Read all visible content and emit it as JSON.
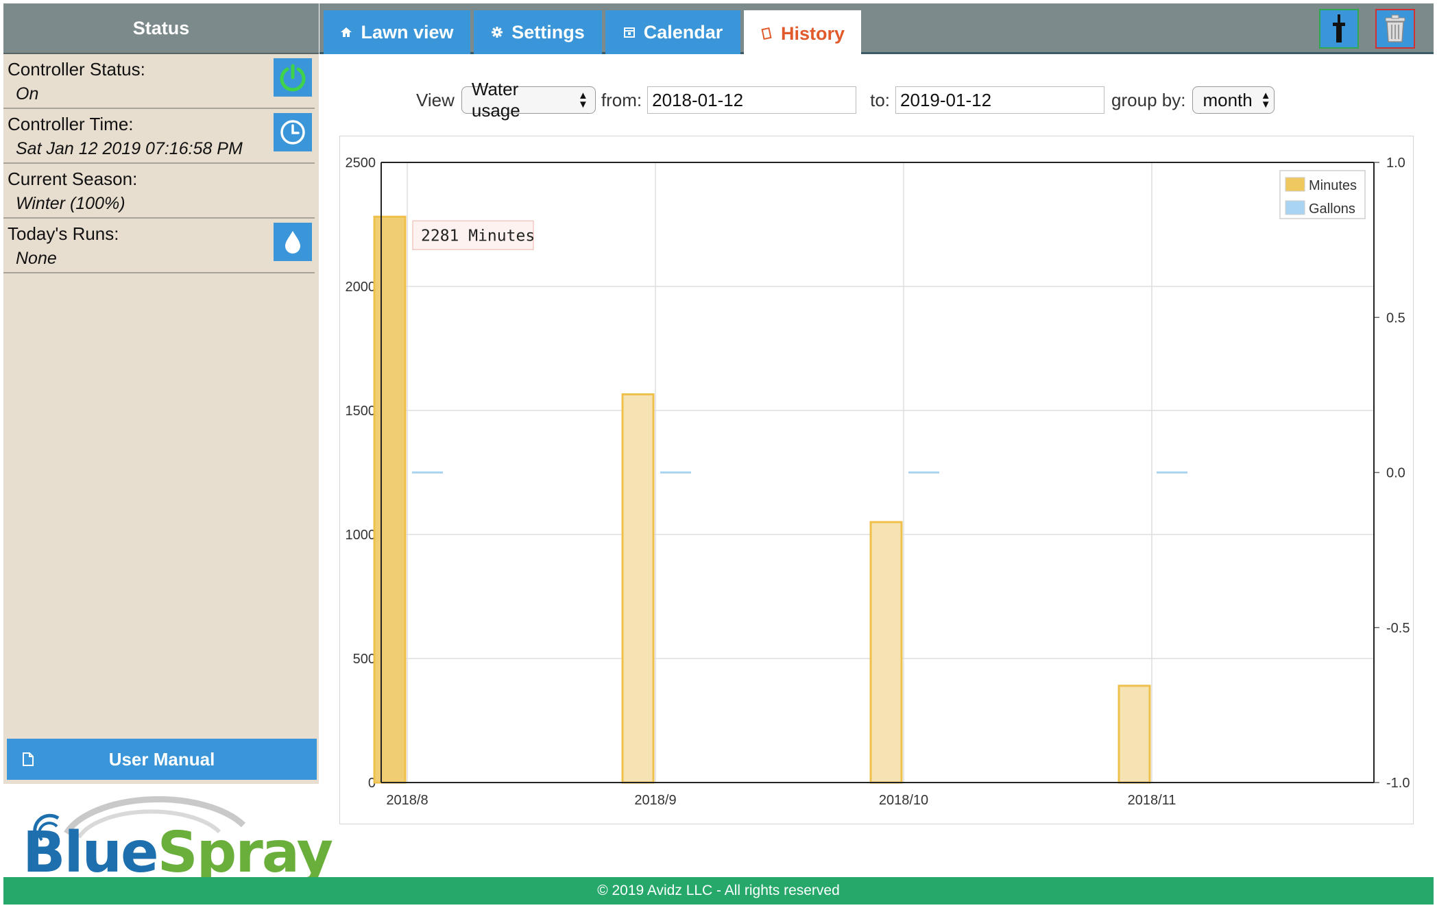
{
  "sidebar": {
    "title": "Status",
    "rows": [
      {
        "label": "Controller Status:",
        "value": "On",
        "icon": "power-icon"
      },
      {
        "label": "Controller Time:",
        "value": "Sat Jan 12 2019 07:16:58 PM",
        "icon": "clock-icon"
      },
      {
        "label": "Current Season:",
        "value": "Winter (100%)",
        "icon": ""
      },
      {
        "label": "Today's Runs:",
        "value": "None",
        "icon": "water-drop-icon"
      }
    ],
    "manual_label": "User Manual",
    "logo": {
      "part1": "Blue",
      "part2": "Spray"
    }
  },
  "tabs": [
    {
      "label": "Lawn view",
      "icon": "home-icon"
    },
    {
      "label": "Settings",
      "icon": "gear-icon"
    },
    {
      "label": "Calendar",
      "icon": "calendar-icon"
    },
    {
      "label": "History",
      "icon": "history-icon",
      "active": true
    }
  ],
  "toolbar": {
    "flush_icon": "sprinkler-icon",
    "delete_icon": "trash-icon"
  },
  "filters": {
    "view_label": "View",
    "view_value": "Water usage",
    "from_label": "from:",
    "from_value": "2018-01-12",
    "to_label": "to:",
    "to_value": "2019-01-12",
    "group_label": "group by:",
    "group_value": "month"
  },
  "chart_data": {
    "type": "bar",
    "categories": [
      "2018/8",
      "2018/9",
      "2018/10",
      "2018/11"
    ],
    "series": [
      {
        "name": "Minutes",
        "axis": "left",
        "values": [
          2281,
          1565,
          1050,
          390
        ],
        "color": "#f0c860"
      },
      {
        "name": "Gallons",
        "axis": "right",
        "values": [
          0,
          0,
          0,
          0
        ],
        "color": "#a9d4f2"
      }
    ],
    "y_left": {
      "min": 0,
      "max": 2500,
      "ticks": [
        0,
        500,
        1000,
        1500,
        2000,
        2500
      ]
    },
    "y_right": {
      "min": -1.0,
      "max": 1.0,
      "ticks": [
        "-1.0",
        "-0.5",
        "0.0",
        "0.5",
        "1.0"
      ]
    },
    "tooltip": "2281 Minutes",
    "highlighted_index": 0,
    "legend_position": "top-right",
    "grid": true
  },
  "footer": {
    "text": "© 2019 Avidz LLC - All rights reserved"
  }
}
